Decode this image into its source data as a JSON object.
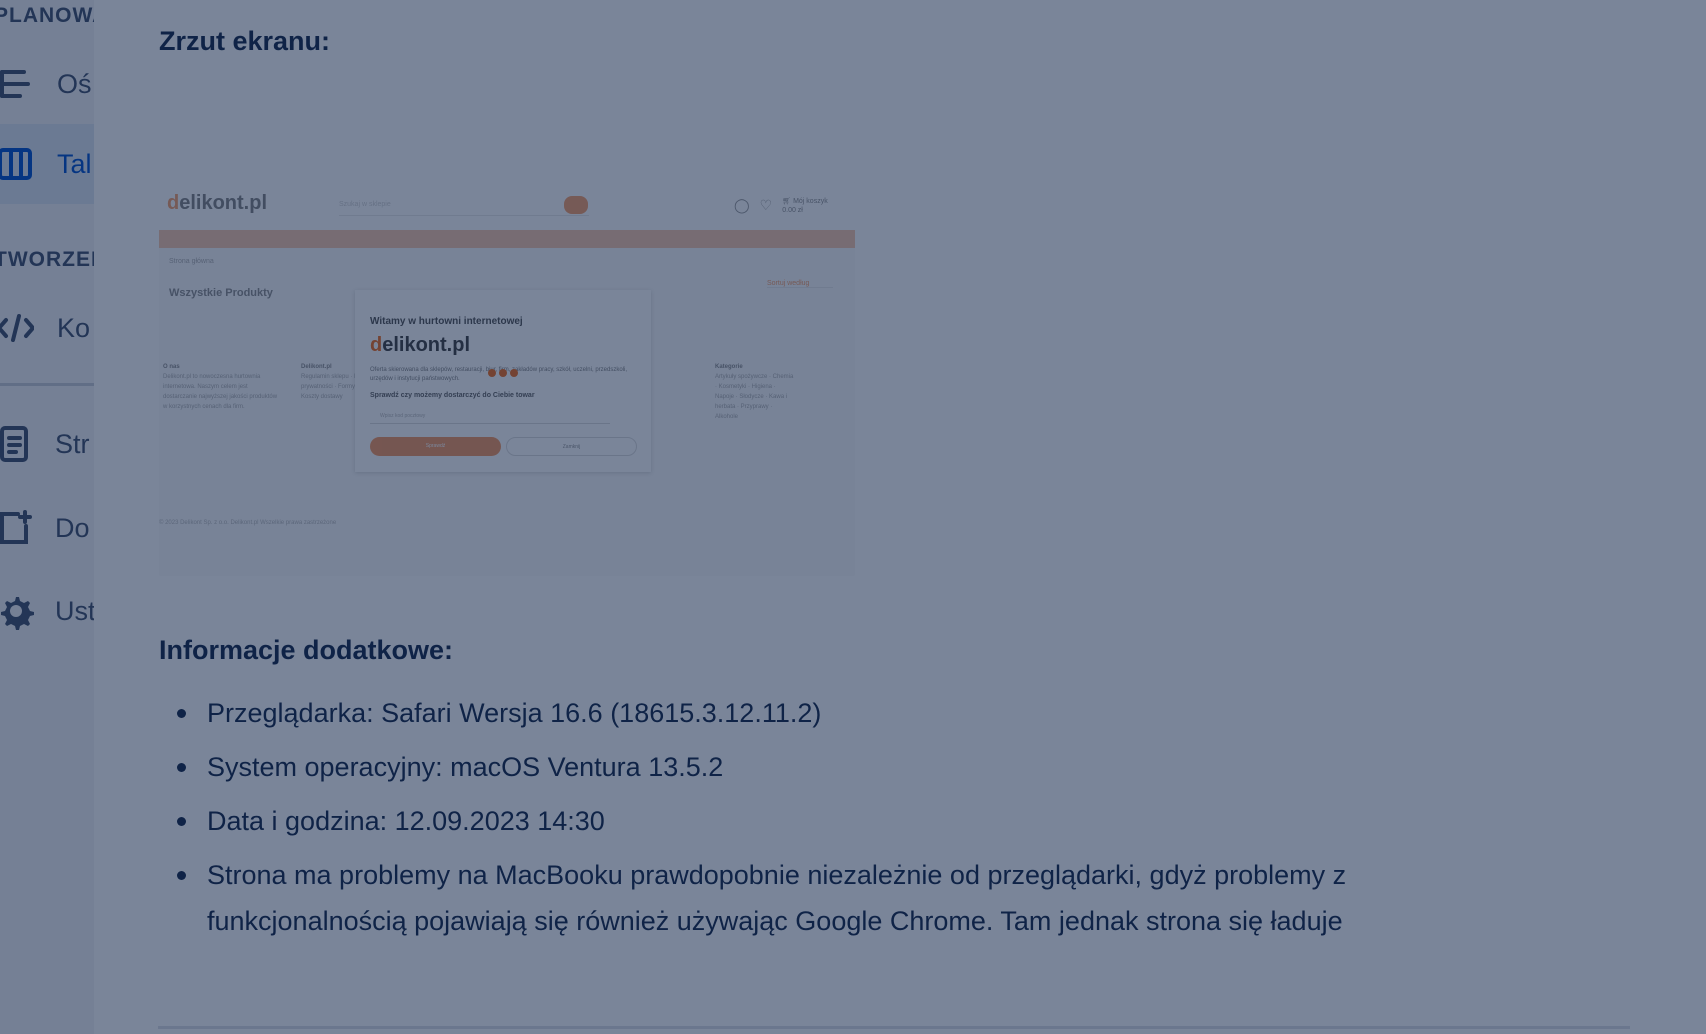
{
  "sidebar": {
    "section_planning": "PLANOWA",
    "section_creation": "TWORZEN",
    "items": [
      {
        "label": "Oś",
        "icon": "timeline-icon"
      },
      {
        "label": "Tal",
        "icon": "board-icon"
      },
      {
        "label": "Ko",
        "icon": "code-icon"
      },
      {
        "label": "Str",
        "icon": "page-icon"
      },
      {
        "label": "Do",
        "icon": "add-shortcut-icon"
      },
      {
        "label": "Ust",
        "icon": "gear-icon"
      }
    ]
  },
  "content": {
    "screenshot_heading": "Zrzut ekranu:",
    "info_heading": "Informacje dodatkowe:",
    "info_items": [
      "Przeglądarka: Safari Wersja 16.6 (18615.3.12.11.2)",
      "System operacyjny: macOS Ventura 13.5.2",
      "Data i godzina: 12.09.2023 14:30",
      "Strona ma problemy na MacBooku prawdopobnie niezależnie od przeglądarki, gdyż problemy z funkcjonalnością pojawiają się również używając Google Chrome. Tam jednak strona się ładuje"
    ]
  },
  "embedded_screenshot": {
    "logo_d": "d",
    "logo_rest": "elikont.pl",
    "search_placeholder": "Szukaj w sklepie",
    "cart_label": "Mój koszyk",
    "cart_value": "0.00 zł",
    "breadcrumb": "Strona główna",
    "page_title": "Wszystkie Produkty",
    "sort_label": "Sortuj według",
    "col1_title": "O nas",
    "col1_text": "Delikont.pl to nowoczesna hurtownia internetowa. Naszym celem jest dostarczanie najwyższej jakości produktów w korzystnych cenach dla firm.",
    "col2_title": "Delikont.pl",
    "col2_text": "Regulamin sklepu · Polityka prywatności · Formy płatności · Koszty dostawy",
    "col3_title": "Kategorie",
    "col3_text": "Artykuły spożywcze · Chemia · Kosmetyki · Higiena · Napoje · Słodycze · Kawa i herbata · Przyprawy · Alkohole",
    "footer": "© 2023 Delikont Sp. z o.o. Delikont.pl Wszelkie prawa zastrzeżone",
    "modal": {
      "title": "Witamy w hurtowni internetowej",
      "logo_d": "d",
      "logo_rest": "elikont.pl",
      "desc": "Oferta skierowana dla sklepów, restauracji, biur, firm, zakładów pracy, szkół, uczelni, przedszkoli, urzędów i instytucji państwowych.",
      "question": "Sprawdź czy możemy dostarczyć do Ciebie towar",
      "input_placeholder": "Wpisz kod pocztowy",
      "check_button": "Sprawdź",
      "skip_button": "Zamknij"
    }
  },
  "colors": {
    "overlay": "#091e42",
    "brand_orange": "#f26f21",
    "text": "#172b4d",
    "active_blue": "#0052cc"
  }
}
